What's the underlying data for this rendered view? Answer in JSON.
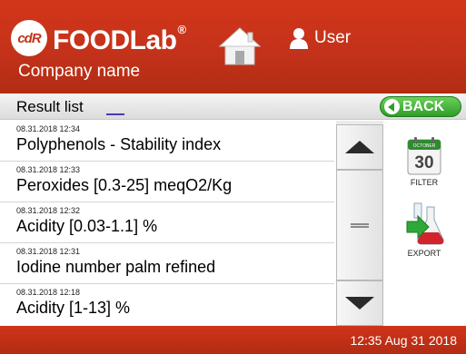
{
  "header": {
    "logo_text": "cdR",
    "brand": "FOODLab",
    "brand_mark": "®",
    "company": "Company name",
    "user_label": "User",
    "home_icon": "home-icon",
    "user_icon": "user-icon"
  },
  "titlebar": {
    "title": "Result list",
    "back_label": "BACK"
  },
  "results": [
    {
      "timestamp": "08.31.2018 12:34",
      "name": "Polyphenols - Stability index"
    },
    {
      "timestamp": "08.31.2018 12:33",
      "name": "Peroxides [0.3-25] meqO2/Kg"
    },
    {
      "timestamp": "08.31.2018 12:32",
      "name": "Acidity [0.03-1.1] %"
    },
    {
      "timestamp": "08.31.2018 12:31",
      "name": "Iodine number palm refined"
    },
    {
      "timestamp": "08.31.2018 12:18",
      "name": "Acidity [1-13] %"
    }
  ],
  "side": {
    "filter_label": "FILTER",
    "calendar_month": "OCTOBER",
    "calendar_day": "30",
    "export_label": "EXPORT"
  },
  "footer": {
    "clock": "12:35  Aug 31 2018"
  },
  "colors": {
    "brand_red": "#c4321a",
    "back_green": "#2f9e2a"
  }
}
